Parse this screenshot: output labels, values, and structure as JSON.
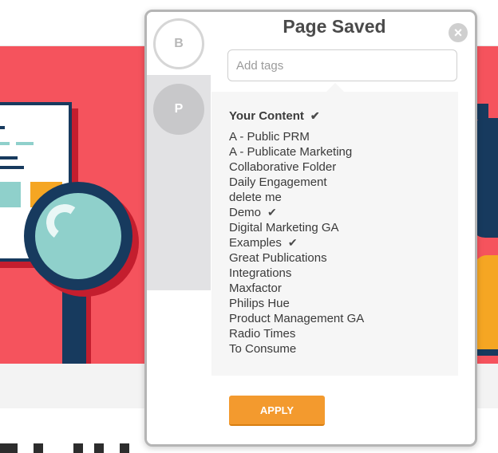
{
  "popup": {
    "title": "Page Saved",
    "close_glyph": "×",
    "tags_placeholder": "Add tags",
    "apply_label": "APPLY",
    "accent_color": "#f39a2e"
  },
  "sidebar": {
    "items": [
      {
        "initial": "B",
        "active": false
      },
      {
        "initial": "P",
        "active": true
      }
    ]
  },
  "content_list": {
    "header": "Your Content",
    "header_checked": true,
    "check_glyph": "✔",
    "items": [
      {
        "label": "A - Public PRM",
        "checked": false
      },
      {
        "label": "A - Publicate Marketing",
        "checked": false
      },
      {
        "label": "Collaborative Folder",
        "checked": false
      },
      {
        "label": "Daily Engagement",
        "checked": false
      },
      {
        "label": "delete me",
        "checked": false
      },
      {
        "label": "Demo",
        "checked": true
      },
      {
        "label": "Digital Marketing GA",
        "checked": false
      },
      {
        "label": "Examples",
        "checked": true
      },
      {
        "label": "Great Publications",
        "checked": false
      },
      {
        "label": "Integrations",
        "checked": false
      },
      {
        "label": "Maxfactor",
        "checked": false
      },
      {
        "label": "Philips Hue",
        "checked": false
      },
      {
        "label": "Product Management GA",
        "checked": false
      },
      {
        "label": "Radio Times",
        "checked": false
      },
      {
        "label": "To Consume",
        "checked": false
      }
    ]
  },
  "background": {
    "hero_color": "#f5535d",
    "navy_color": "#173a5e"
  }
}
